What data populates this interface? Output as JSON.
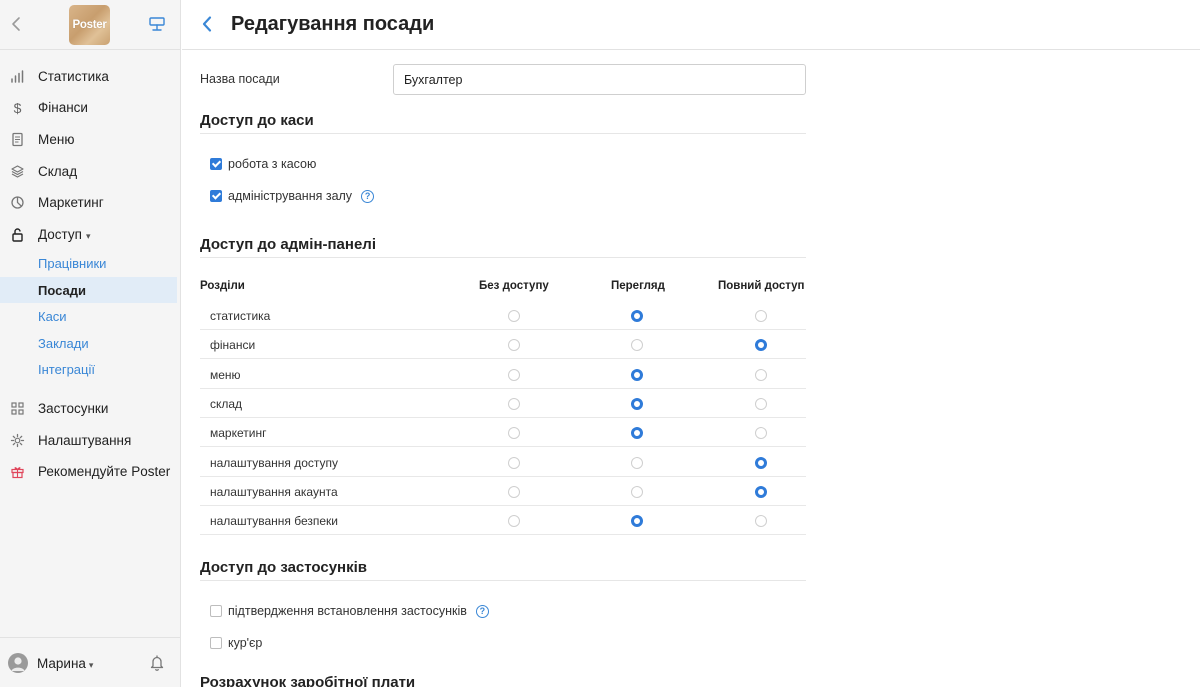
{
  "sidebar": {
    "logo_text": "Poster",
    "nav": [
      {
        "label": "Статистика",
        "icon": "bar-chart-icon"
      },
      {
        "label": "Фінанси",
        "icon": "dollar-icon"
      },
      {
        "label": "Меню",
        "icon": "document-icon"
      },
      {
        "label": "Склад",
        "icon": "layers-icon"
      },
      {
        "label": "Маркетинг",
        "icon": "pie-icon"
      },
      {
        "label": "Доступ",
        "icon": "lock-icon",
        "caret": "▾"
      },
      {
        "label": "Застосунки",
        "icon": "grid-icon"
      },
      {
        "label": "Налаштування",
        "icon": "gear-icon"
      },
      {
        "label": "Рекомендуйте Poster",
        "icon": "gift-icon"
      }
    ],
    "sub_nav": [
      {
        "label": "Працівники"
      },
      {
        "label": "Посади",
        "active": true
      },
      {
        "label": "Каси"
      },
      {
        "label": "Заклади"
      },
      {
        "label": "Інтеграції"
      }
    ],
    "user": {
      "name": "Марина",
      "caret": "▾"
    }
  },
  "header": {
    "title": "Редагування посади"
  },
  "form": {
    "position_label": "Назва посади",
    "position_value": "Бухгалтер"
  },
  "cash_access": {
    "title": "Доступ до каси",
    "items": [
      {
        "label": "робота з касою",
        "checked": true,
        "help": false
      },
      {
        "label": "адміністрування залу",
        "checked": true,
        "help": true
      }
    ]
  },
  "admin_access": {
    "title": "Доступ до адмін-панелі",
    "columns": [
      "Розділи",
      "Без доступу",
      "Перегляд",
      "Повний доступ"
    ],
    "rows": [
      {
        "name": "статистика",
        "level": 1
      },
      {
        "name": "фінанси",
        "level": 2
      },
      {
        "name": "меню",
        "level": 1
      },
      {
        "name": "склад",
        "level": 1
      },
      {
        "name": "маркетинг",
        "level": 1
      },
      {
        "name": "налаштування доступу",
        "level": 2
      },
      {
        "name": "налаштування акаунта",
        "level": 2
      },
      {
        "name": "налаштування безпеки",
        "level": 1
      }
    ]
  },
  "apps_access": {
    "title": "Доступ до застосунків",
    "items": [
      {
        "label": "підтвердження встановлення застосунків",
        "checked": false,
        "help": true
      },
      {
        "label": "кур'єр",
        "checked": false,
        "help": false
      }
    ]
  },
  "salary": {
    "title": "Розрахунок заробітної плати"
  },
  "colors": {
    "accent": "#2f7bd9",
    "link": "#3a87d6",
    "active_bg": "#e1ecf7"
  }
}
